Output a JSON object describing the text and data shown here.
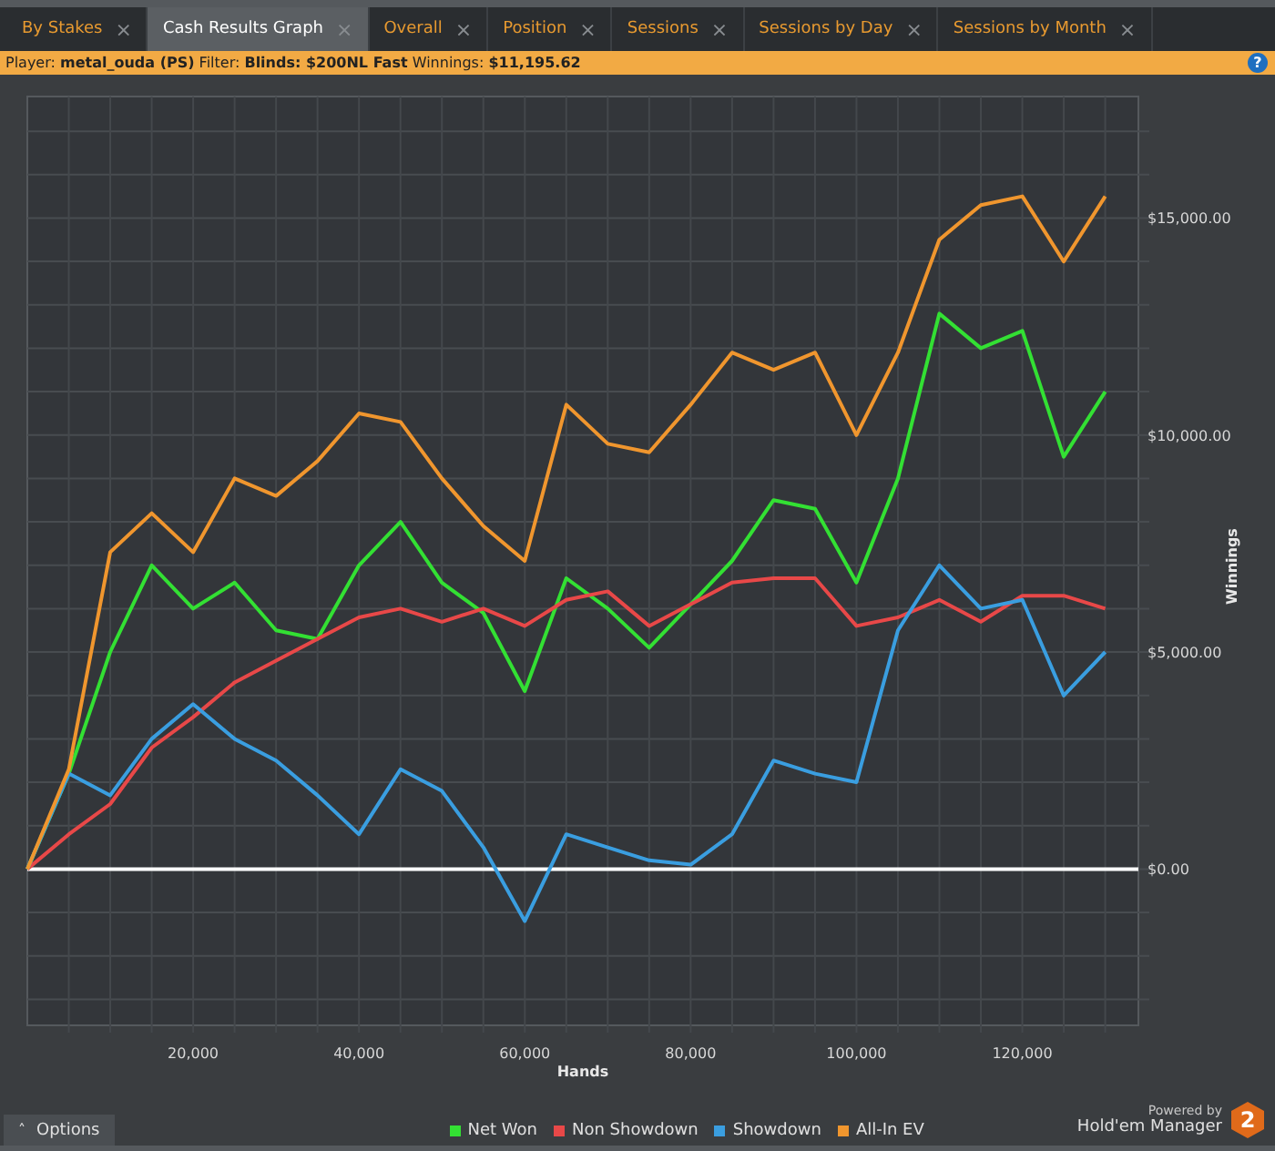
{
  "tabs": [
    {
      "label": "By Stakes",
      "close": "×",
      "selected": false
    },
    {
      "label": "Cash Results Graph",
      "close": "×",
      "selected": true
    },
    {
      "label": "Overall",
      "close": "×",
      "selected": false
    },
    {
      "label": "Position",
      "close": "×",
      "selected": false
    },
    {
      "label": "Sessions",
      "close": "×",
      "selected": false
    },
    {
      "label": "Sessions by Day",
      "close": "×",
      "selected": false
    },
    {
      "label": "Sessions by Month",
      "close": "×",
      "selected": false
    }
  ],
  "info_bar": {
    "text": "Player: **metal_ouda (PS)** Filter: **Blinds: $200NL Fast** Winnings: **$11,195.62**",
    "help": "?"
  },
  "chart": {
    "chart_data": {
      "type": "line",
      "xlabel": "Hands",
      "ylabel": "Winnings",
      "x": [
        0,
        5000,
        10000,
        15000,
        20000,
        25000,
        30000,
        35000,
        40000,
        45000,
        50000,
        55000,
        60000,
        65000,
        70000,
        75000,
        80000,
        85000,
        90000,
        95000,
        100000,
        105000,
        110000,
        115000,
        120000,
        125000,
        130000
      ],
      "series": [
        {
          "name": "Net Won",
          "color": "#33e033",
          "values": [
            0,
            2200,
            5000,
            7000,
            6000,
            6600,
            5500,
            5300,
            7000,
            8000,
            6600,
            5900,
            4100,
            6700,
            6000,
            5100,
            6100,
            7100,
            8500,
            8300,
            6600,
            9000,
            12800,
            12000,
            12400,
            9500,
            11000
          ]
        },
        {
          "name": "Non Showdown",
          "color": "#e84848",
          "values": [
            0,
            800,
            1500,
            2800,
            3500,
            4300,
            4800,
            5300,
            5800,
            6000,
            5700,
            6000,
            5600,
            6200,
            6400,
            5600,
            6100,
            6600,
            6700,
            6700,
            5600,
            5800,
            6200,
            5700,
            6300,
            6300,
            6000
          ]
        },
        {
          "name": "Showdown",
          "color": "#3a9ee0",
          "values": [
            0,
            2200,
            1700,
            3000,
            3800,
            3000,
            2500,
            1700,
            800,
            2300,
            1800,
            500,
            -1200,
            800,
            500,
            200,
            100,
            800,
            2500,
            2200,
            2000,
            5500,
            7000,
            6000,
            6200,
            4000,
            5000
          ]
        },
        {
          "name": "All-In EV",
          "color": "#f0962e",
          "values": [
            0,
            2300,
            7300,
            8200,
            7300,
            9000,
            8600,
            9400,
            10500,
            10300,
            9000,
            7900,
            7100,
            10700,
            9800,
            9600,
            10700,
            11900,
            11500,
            11900,
            10000,
            11900,
            14500,
            15300,
            15500,
            14000,
            15500
          ]
        }
      ],
      "grid": true,
      "xlim": [
        0,
        134000
      ],
      "ylim": [
        -3600,
        17800
      ],
      "xticks": [
        {
          "value": 20000,
          "label": "20,000"
        },
        {
          "value": 40000,
          "label": "40,000"
        },
        {
          "value": 60000,
          "label": "60,000"
        },
        {
          "value": 80000,
          "label": "80,000"
        },
        {
          "value": 100000,
          "label": "100,000"
        },
        {
          "value": 120000,
          "label": "120,000"
        }
      ],
      "yticks": [
        {
          "value": 0,
          "label": "$0.00"
        },
        {
          "value": 5000,
          "label": "$5,000.00"
        },
        {
          "value": 10000,
          "label": "$10,000.00"
        },
        {
          "value": 15000,
          "label": "$15,000.00"
        }
      ]
    }
  },
  "bottom_bar": {
    "options_button": {
      "icon": "˄",
      "label": "Options"
    },
    "logo": {
      "tagline": "Powered by",
      "name": "Hold'em Manager",
      "badge": "2"
    }
  }
}
